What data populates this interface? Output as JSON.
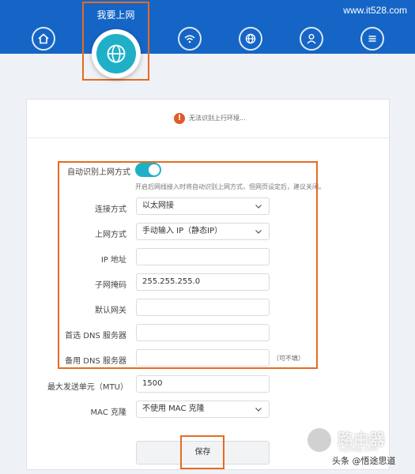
{
  "header": {
    "site": "www.it528.com",
    "active_tab_label": "我要上网",
    "nav_icons": [
      "home-icon",
      "globe-icon",
      "wifi-icon",
      "router-globe-icon",
      "user-icon",
      "menu-icon"
    ]
  },
  "status": {
    "icon": "!",
    "text": "无法识别上行环境..."
  },
  "form": {
    "auto_detect_label": "自动识别上网方式",
    "auto_detect_on": true,
    "auto_detect_hint": "开启后网线接入时将自动识别上网方式，但网页设定后，建议关闭。",
    "connection_type_label": "连接方式",
    "connection_type_value": "以太网接",
    "wan_type_label": "上网方式",
    "wan_type_value": "手动输入 IP（静态IP）",
    "ip_label": "IP 地址",
    "ip_value": "",
    "mask_label": "子网掩码",
    "mask_value": "255.255.255.0",
    "gateway_label": "默认网关",
    "gateway_value": "",
    "dns1_label": "首选 DNS 服务器",
    "dns1_value": "",
    "dns2_label": "备用 DNS 服务器",
    "dns2_value": "",
    "dns2_optional": "（可不填）",
    "mtu_label": "最大发送单元（MTU）",
    "mtu_value": "1500",
    "mac_label": "MAC 克隆",
    "mac_value": "不使用 MAC 克隆",
    "save_label": "保存"
  },
  "watermark": {
    "text": "路由器",
    "sub": "luyouqi.com"
  },
  "credit": "头条 @悟途思道",
  "colors": {
    "header": "#1565c6",
    "accent": "#1fb0c8",
    "highlight": "#e86a1f"
  }
}
